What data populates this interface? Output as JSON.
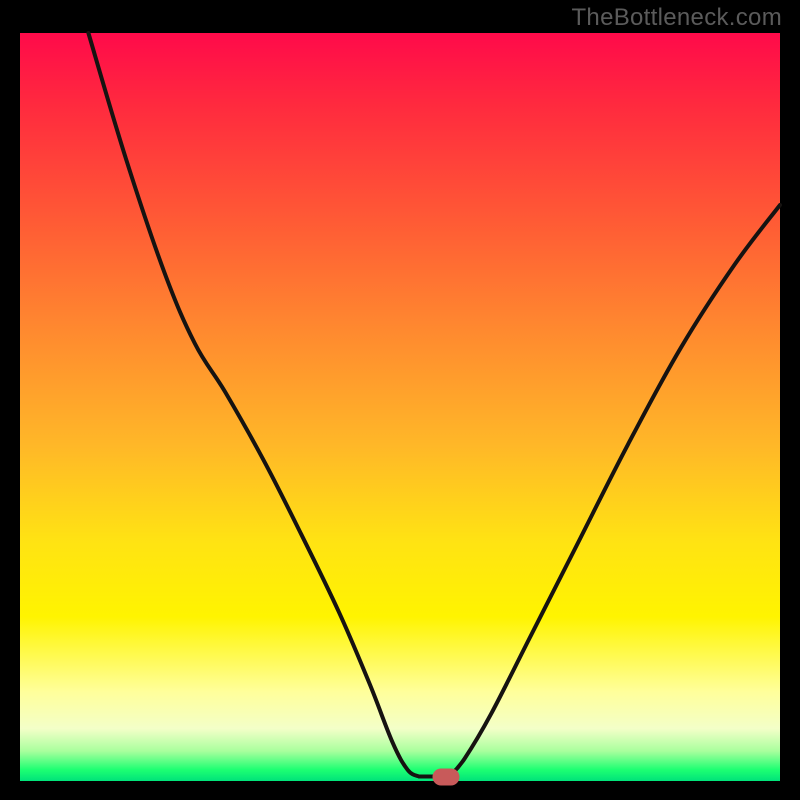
{
  "watermark": "TheBottleneck.com",
  "colors": {
    "frame_bg": "#000000",
    "curve_stroke": "#161311",
    "marker_fill": "#c85a5a",
    "watermark_text": "#5b5b5b"
  },
  "gradient_stops": [
    {
      "pct": 0,
      "hex": "#ff0a4a"
    },
    {
      "pct": 10,
      "hex": "#ff2b3e"
    },
    {
      "pct": 25,
      "hex": "#ff5a35"
    },
    {
      "pct": 40,
      "hex": "#ff8a2f"
    },
    {
      "pct": 55,
      "hex": "#ffb728"
    },
    {
      "pct": 68,
      "hex": "#ffe313"
    },
    {
      "pct": 78,
      "hex": "#fff400"
    },
    {
      "pct": 88,
      "hex": "#ffff9a"
    },
    {
      "pct": 93,
      "hex": "#f3ffc8"
    },
    {
      "pct": 96,
      "hex": "#a9ff9d"
    },
    {
      "pct": 98.5,
      "hex": "#1dff72"
    },
    {
      "pct": 100,
      "hex": "#00e27a"
    }
  ],
  "chart_data": {
    "type": "line",
    "title": "",
    "xlabel": "",
    "ylabel": "",
    "left_branch": [
      {
        "x": 0.09,
        "y": 1.0
      },
      {
        "x": 0.14,
        "y": 0.83
      },
      {
        "x": 0.19,
        "y": 0.68
      },
      {
        "x": 0.23,
        "y": 0.585
      },
      {
        "x": 0.27,
        "y": 0.52
      },
      {
        "x": 0.32,
        "y": 0.43
      },
      {
        "x": 0.37,
        "y": 0.33
      },
      {
        "x": 0.42,
        "y": 0.225
      },
      {
        "x": 0.46,
        "y": 0.13
      },
      {
        "x": 0.49,
        "y": 0.052
      },
      {
        "x": 0.51,
        "y": 0.015
      },
      {
        "x": 0.525,
        "y": 0.006
      }
    ],
    "flat_segment": [
      {
        "x": 0.525,
        "y": 0.006
      },
      {
        "x": 0.565,
        "y": 0.006
      }
    ],
    "right_branch": [
      {
        "x": 0.565,
        "y": 0.006
      },
      {
        "x": 0.585,
        "y": 0.03
      },
      {
        "x": 0.62,
        "y": 0.09
      },
      {
        "x": 0.67,
        "y": 0.19
      },
      {
        "x": 0.73,
        "y": 0.31
      },
      {
        "x": 0.8,
        "y": 0.45
      },
      {
        "x": 0.87,
        "y": 0.58
      },
      {
        "x": 0.94,
        "y": 0.69
      },
      {
        "x": 1.0,
        "y": 0.77
      }
    ],
    "marker": {
      "x": 0.56,
      "y": 0.006
    },
    "xlim": [
      0,
      1
    ],
    "ylim": [
      0,
      1
    ],
    "note": "Values are fractions of the plot-area width/height. y=0 is the bottom edge, y=1 the top edge."
  }
}
